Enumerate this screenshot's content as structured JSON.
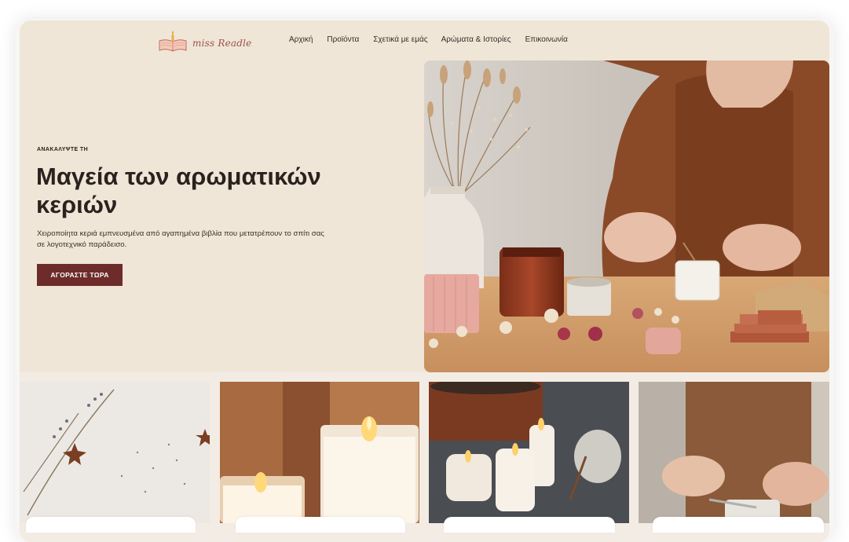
{
  "brand": {
    "name": "miss Readle"
  },
  "nav": {
    "items": [
      "Αρχική",
      "Προϊόντα",
      "Σχετικά με εμάς",
      "Αρώματα & Ιστορίες",
      "Επικοινωνία"
    ]
  },
  "hero": {
    "eyebrow": "ΑΝΑΚΑΛΥΨΤΕ ΤΗ",
    "headline": "Μαγεία των αρωματικών κεριών",
    "description": "Χειροποίητα κεριά εμπνευσμένα από αγαπημένα βιβλία που μετατρέπουν το σπίτι σας σε λογοτεχνικό παράδεισο.",
    "cta_label": "ΑΓΟΡΑΣΤΕ ΤΩΡΑ"
  },
  "colors": {
    "background": "#efe6d8",
    "accent": "#6d2b2a",
    "brand_text": "#a0504a",
    "heading": "#2b211e"
  }
}
